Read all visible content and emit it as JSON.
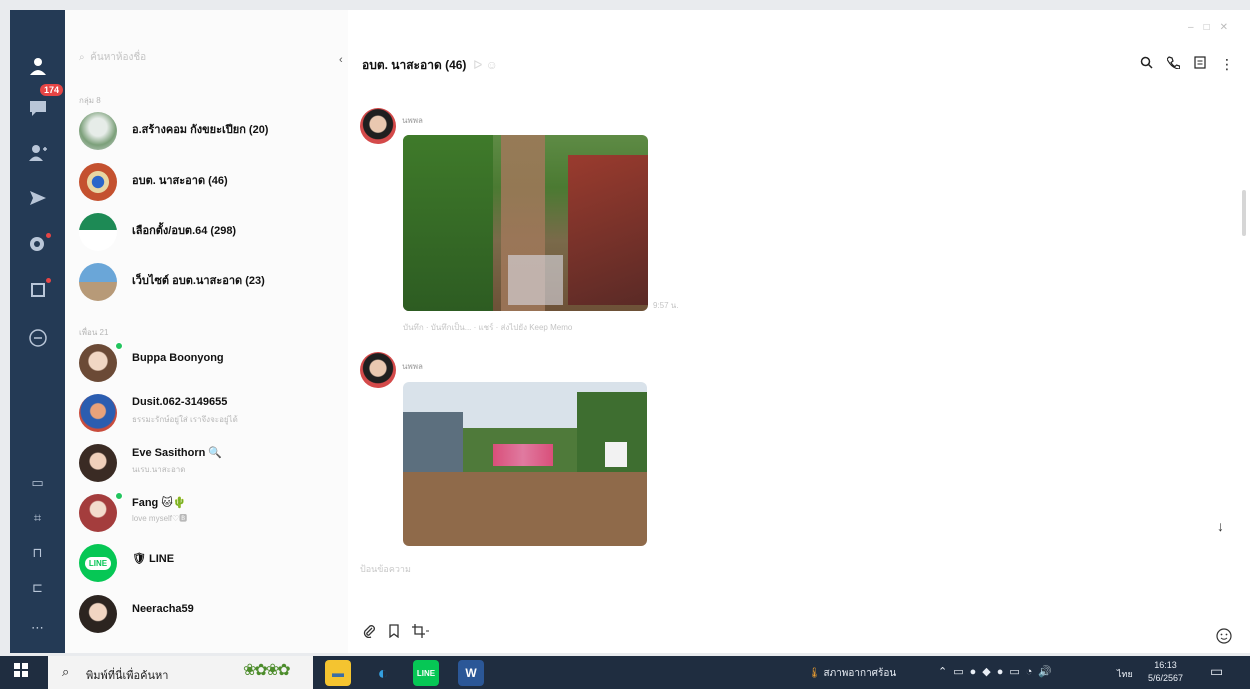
{
  "rail": {
    "chats_badge": "174"
  },
  "chat_list": {
    "search_placeholder": "ค้นหาห้องชื่อ",
    "groups_label": "กลุ่ม 8",
    "friends_label": "เพื่อน 21",
    "groups": [
      {
        "name": "อ.สร้างคอม กังขยะเปียก (20)"
      },
      {
        "name": "อบต. นาสะอาด (46)"
      },
      {
        "name": "เลือกตั้ง/อบต.64 (298)"
      },
      {
        "name": "เว็บไซต์ อบต.นาสะอาด (23)"
      }
    ],
    "friends": [
      {
        "name": "Buppa Boonyong",
        "sub": ""
      },
      {
        "name": "Dusit.062-3149655",
        "sub": "ธรรมะรักษ์อยู่ใส่ เราจึงจะอยู่ได้"
      },
      {
        "name": "Eve Sasithorn 🔍",
        "sub": "นเรบ.นาสะอาด"
      },
      {
        "name": "Fang 🐱🌵",
        "sub": "love myself♡🅱"
      },
      {
        "name": "🛡 LINE",
        "sub": ""
      },
      {
        "name": "Neeracha59",
        "sub": ""
      }
    ]
  },
  "chat": {
    "title": "อบต. นาสะอาด (46)",
    "messages": [
      {
        "sender": "นพพล",
        "time": "9:57 น.",
        "actions": "บันทึก · บันทึกเป็น... · แชร์ · ส่งไปยัง Keep Memo"
      },
      {
        "sender": "นพพล"
      }
    ],
    "input_placeholder": "ป้อนข้อความ"
  },
  "taskbar": {
    "search_text": "พิมพ์ที่นี่เพื่อค้นหา",
    "weather": "สภาพอากาศร้อน",
    "lang": "ไทย",
    "time": "16:13",
    "date": "5/6/2567"
  },
  "colors": {
    "rail_bg": "#243a55",
    "badge": "#e64545",
    "taskbar_bg": "#1f2d40",
    "line_green": "#06c755"
  },
  "icons": [
    "profile-icon",
    "chat-icon",
    "add-friend-icon",
    "send-icon",
    "calendar-icon",
    "keep-icon",
    "openchat-icon",
    "search-icon",
    "phone-icon",
    "note-icon",
    "more-icon",
    "attach-icon",
    "bookmark-icon",
    "crop-icon",
    "emoji-icon",
    "arrow-down-icon",
    "windows-start-icon"
  ]
}
